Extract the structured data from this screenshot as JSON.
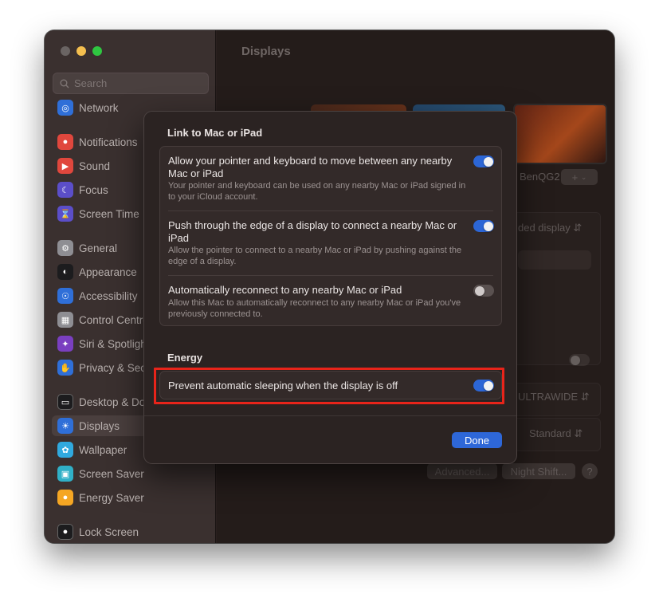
{
  "window": {
    "title": "Displays"
  },
  "sidebar": {
    "search_placeholder": "Search",
    "items": [
      {
        "label": "Network",
        "icon": "globe-icon",
        "color": "#2f6fd8"
      },
      {
        "label": "Notifications",
        "icon": "bell-icon",
        "color": "#e0473d"
      },
      {
        "label": "Sound",
        "icon": "speaker-icon",
        "color": "#e0473d"
      },
      {
        "label": "Focus",
        "icon": "moon-icon",
        "color": "#5b4ec9"
      },
      {
        "label": "Screen Time",
        "icon": "hourglass-icon",
        "color": "#5b4ec9"
      },
      {
        "label": "General",
        "icon": "gear-icon",
        "color": "#8e8e93"
      },
      {
        "label": "Appearance",
        "icon": "appearance-icon",
        "color": "#1c1c1e"
      },
      {
        "label": "Accessibility",
        "icon": "accessibility-icon",
        "color": "#2f6fd8"
      },
      {
        "label": "Control Centre",
        "icon": "control-centre-icon",
        "color": "#8e8e93"
      },
      {
        "label": "Siri & Spotlight",
        "icon": "siri-icon",
        "color": "#7a3fc0"
      },
      {
        "label": "Privacy & Security",
        "icon": "hand-icon",
        "color": "#2f6fd8"
      },
      {
        "label": "Desktop & Dock",
        "icon": "dock-icon",
        "color": "#1c1c1e"
      },
      {
        "label": "Displays",
        "icon": "sun-icon",
        "color": "#2f6fd8"
      },
      {
        "label": "Wallpaper",
        "icon": "wallpaper-icon",
        "color": "#30a9de"
      },
      {
        "label": "Screen Saver",
        "icon": "screen-saver-icon",
        "color": "#30b0c7"
      },
      {
        "label": "Energy Saver",
        "icon": "bulb-icon",
        "color": "#f5a623"
      },
      {
        "label": "Lock Screen",
        "icon": "lock-icon",
        "color": "#1c1c1e"
      }
    ]
  },
  "background": {
    "display_name": "BenQG2",
    "add_button": "+",
    "extended_display": "ded display",
    "monitor_select": "ULTRAWIDE",
    "standard_select": "Standard",
    "advanced_button": "Advanced...",
    "night_shift_button": "Night Shift...",
    "help_button": "?"
  },
  "popup": {
    "link_section_title": "Link to Mac or iPad",
    "rows": [
      {
        "title": "Allow your pointer and keyboard to move between any nearby Mac or iPad",
        "desc": "Your pointer and keyboard can be used on any nearby Mac or iPad signed in to your iCloud account.",
        "on": true
      },
      {
        "title": "Push through the edge of a display to connect a nearby Mac or iPad",
        "desc": "Allow the pointer to connect to a nearby Mac or iPad by pushing against the edge of a display.",
        "on": true
      },
      {
        "title": "Automatically reconnect to any nearby Mac or iPad",
        "desc": "Allow this Mac to automatically reconnect to any nearby Mac or iPad you've previously connected to.",
        "on": false
      }
    ],
    "energy_section_title": "Energy",
    "energy_row": {
      "title": "Prevent automatic sleeping when the display is off",
      "on": true
    },
    "done_label": "Done"
  },
  "colors": {
    "accent": "#2e67d8",
    "highlight": "#e8241a"
  }
}
